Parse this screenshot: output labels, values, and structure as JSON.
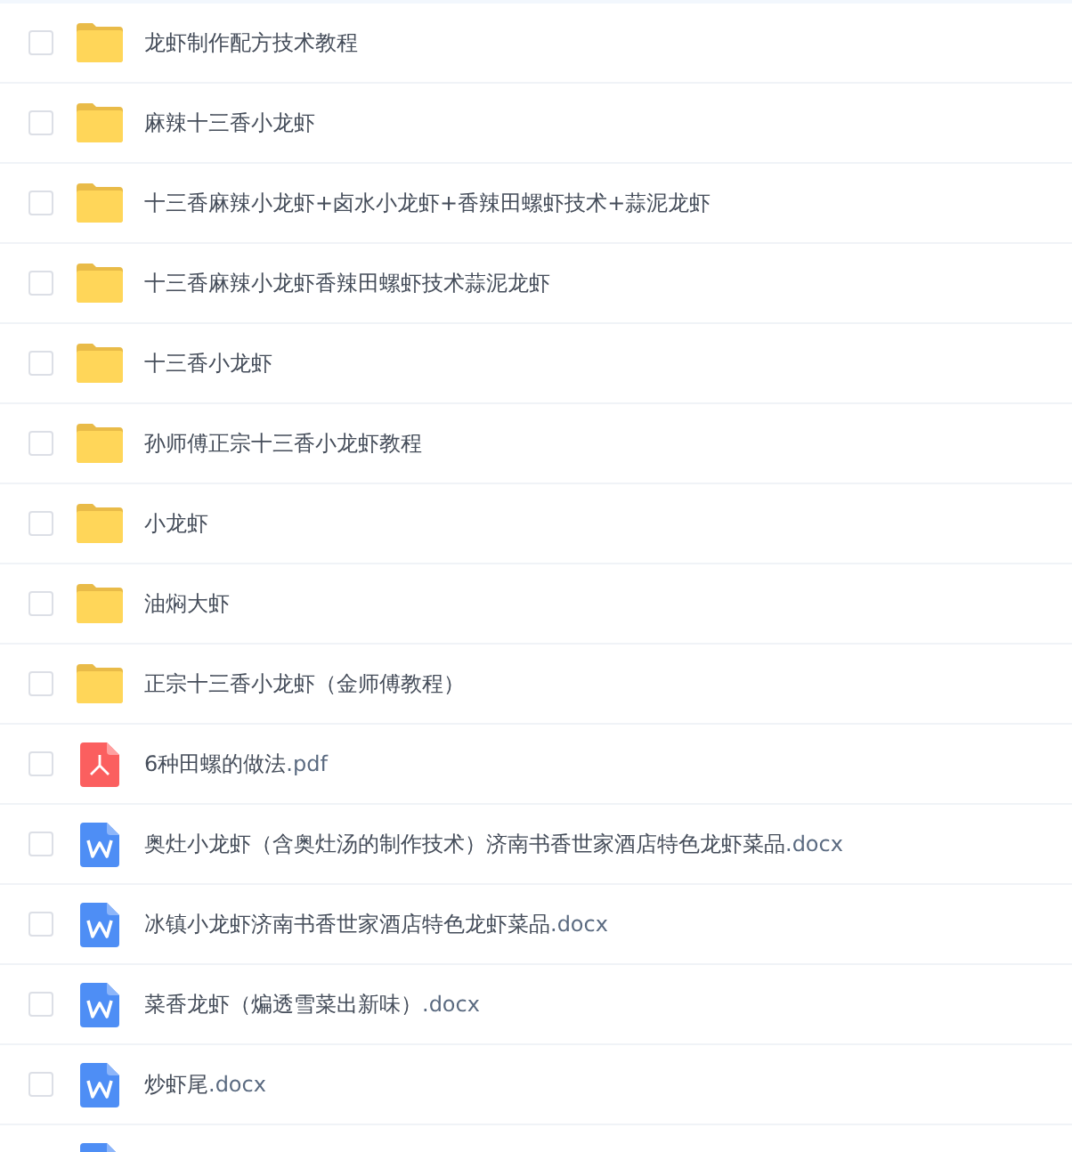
{
  "files": [
    {
      "kind": "folder",
      "name": "龙虾制作配方技术教程",
      "checked": false
    },
    {
      "kind": "folder",
      "name": "麻辣十三香小龙虾",
      "checked": false
    },
    {
      "kind": "folder",
      "name": "十三香麻辣小龙虾+卤水小龙虾+香辣田螺虾技术+蒜泥龙虾",
      "checked": false
    },
    {
      "kind": "folder",
      "name": "十三香麻辣小龙虾香辣田螺虾技术蒜泥龙虾",
      "checked": false
    },
    {
      "kind": "folder",
      "name": "十三香小龙虾",
      "checked": false
    },
    {
      "kind": "folder",
      "name": "孙师傅正宗十三香小龙虾教程",
      "checked": false
    },
    {
      "kind": "folder",
      "name": "小龙虾",
      "checked": false
    },
    {
      "kind": "folder",
      "name": "油焖大虾",
      "checked": false
    },
    {
      "kind": "folder",
      "name": "正宗十三香小龙虾（金师傅教程）",
      "checked": false
    },
    {
      "kind": "pdf",
      "name": "6种田螺的做法",
      "ext": ".pdf",
      "checked": false
    },
    {
      "kind": "doc",
      "name": "奥灶小龙虾（含奥灶汤的制作技术）济南书香世家酒店特色龙虾菜品",
      "ext": ".docx",
      "checked": false
    },
    {
      "kind": "doc",
      "name": "冰镇小龙虾济南书香世家酒店特色龙虾菜品",
      "ext": ".docx",
      "checked": false
    },
    {
      "kind": "doc",
      "name": "菜香龙虾（煸透雪菜出新味）",
      "ext": ".docx",
      "checked": false
    },
    {
      "kind": "doc",
      "name": "炒虾尾",
      "ext": ".docx",
      "checked": false
    },
    {
      "kind": "doc"
    }
  ]
}
